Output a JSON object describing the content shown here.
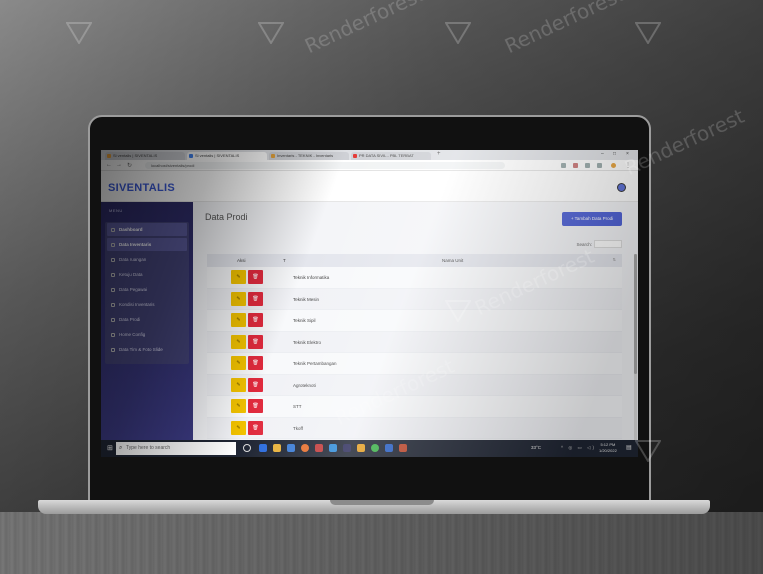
{
  "browser": {
    "tabs": [
      {
        "label": "Si ventalis | SIVENTALIS",
        "color": "#f4a73b",
        "active": false
      },
      {
        "label": "Si ventalis | SIVENTALIS",
        "color": "#4285f4",
        "active": true
      },
      {
        "label": "Inventaris - TEKNIK - Inventaris",
        "color": "#e4a33a",
        "active": false
      },
      {
        "label": "PR DATA SIVIL - PBL TERBAT",
        "color": "#e53935",
        "active": false
      }
    ],
    "url": "localhost/siventalis/prodi"
  },
  "app": {
    "brand": "SIVENTALIS",
    "menu_title": "MENU",
    "menu": [
      {
        "label": "Dashboard",
        "active": true
      },
      {
        "label": "Data Inventaris",
        "active": true
      },
      {
        "label": "Data ruangan",
        "active": false
      },
      {
        "label": "Ketuju Data",
        "active": false
      },
      {
        "label": "Data Pegawai",
        "active": false
      },
      {
        "label": "Kondisi Inventaris",
        "active": false
      },
      {
        "label": "Data Prodi",
        "active": false
      },
      {
        "label": "Home Config",
        "active": false
      },
      {
        "label": "Data Tim & Foto Slide",
        "active": false
      }
    ]
  },
  "main": {
    "page_title": "Data Prodi",
    "add_button": "+ Tambah Data Prodi",
    "search_label": "Search:",
    "table": {
      "headers": {
        "aksi": "Aksi",
        "t": "T",
        "nama": "Nama Unit"
      },
      "rows": [
        {
          "name": "Teknik Informatika"
        },
        {
          "name": "Teknik Mesin"
        },
        {
          "name": "Teknik Sipil"
        },
        {
          "name": "Teknik Elektro"
        },
        {
          "name": "Teknik Pertambangan"
        },
        {
          "name": "Agroteknoti"
        },
        {
          "name": "STT"
        },
        {
          "name": "Tkoff"
        }
      ]
    }
  },
  "taskbar": {
    "search_placeholder": "Type here to search",
    "temperature": "33°C",
    "time": "5:12 PM",
    "date": "1/20/2022"
  },
  "watermark": "Renderforest",
  "colors": {
    "brand": "#3b5bdb",
    "sidebar": "#2e2c68",
    "edit_button": "#f2c200",
    "delete_button": "#e02a3d",
    "add_button": "#4c5fd6"
  }
}
